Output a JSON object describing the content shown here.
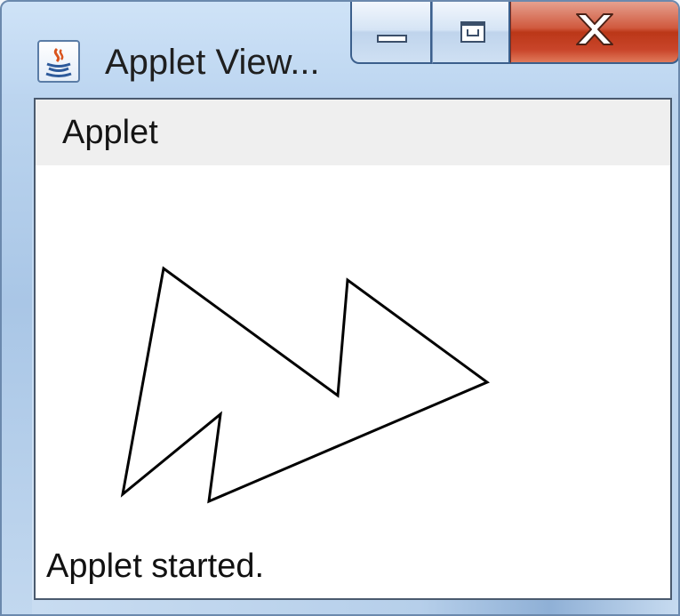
{
  "window": {
    "title": "Applet View..."
  },
  "menu": {
    "items": [
      {
        "label": "Applet"
      }
    ]
  },
  "status": {
    "text": "Applet started."
  },
  "icons": {
    "app": "java-coffee-icon",
    "minimize": "minimize-icon",
    "maximize": "maximize-icon",
    "close": "close-icon"
  },
  "colors": {
    "close_button": "#c9452a",
    "title_bar": "#b9d3ef",
    "drawing_stroke": "#000000"
  }
}
